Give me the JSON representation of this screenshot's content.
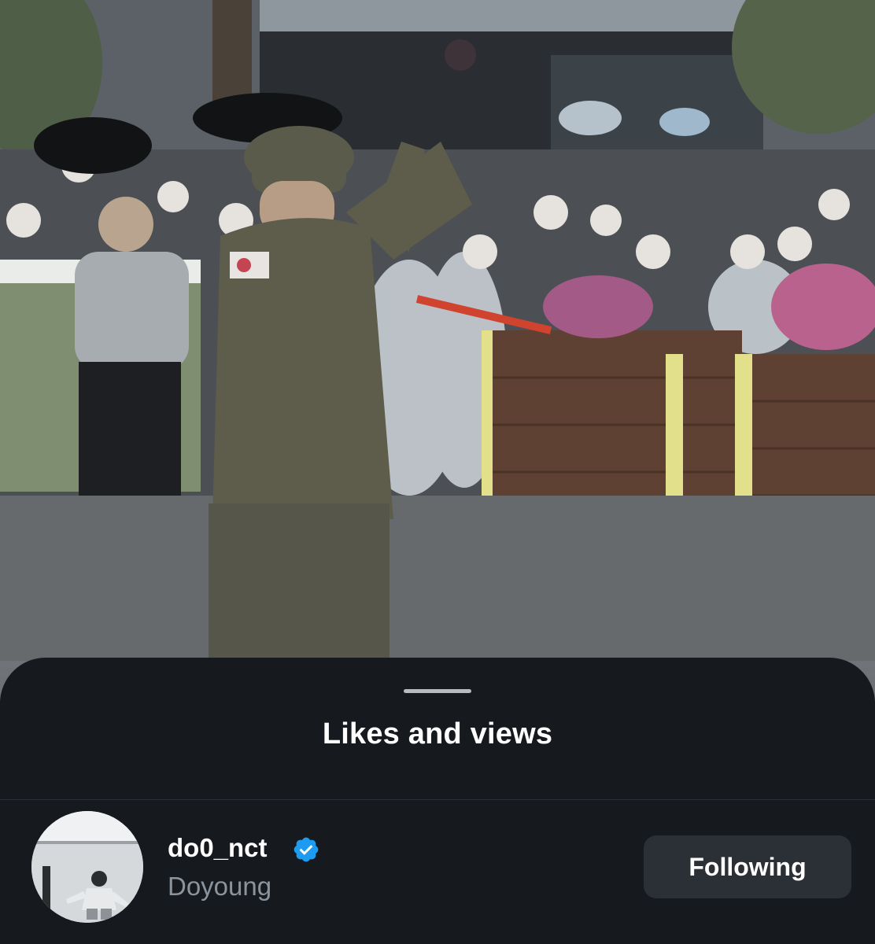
{
  "sheet": {
    "title": "Likes and views"
  },
  "user": {
    "username": "do0_nct",
    "display_name": "Doyoung",
    "verified": true,
    "follow_button_label": "Following"
  },
  "icons": {
    "verified": "verified-badge-icon"
  },
  "colors": {
    "sheet_background": "#16191d",
    "button_background": "#2b3036",
    "verified_blue": "#1d9bf0",
    "secondary_text": "#8b949d"
  }
}
